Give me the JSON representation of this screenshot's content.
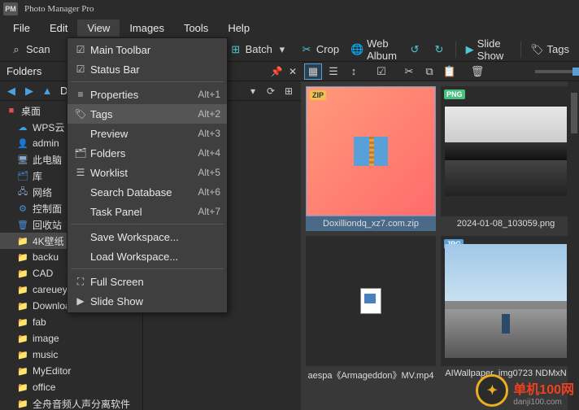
{
  "app": {
    "logo": "PM",
    "title": "Photo Manager Pro"
  },
  "menubar": {
    "file": "File",
    "edit": "Edit",
    "view": "View",
    "images": "Images",
    "tools": "Tools",
    "help": "Help"
  },
  "toolbar": {
    "scan": "Scan",
    "batch": "Batch",
    "crop": "Crop",
    "webalbum": "Web Album",
    "slideshow": "Slide Show",
    "tags": "Tags"
  },
  "folders_label": "Folders",
  "breadcrumb": "D",
  "view_menu": {
    "main_toolbar": "Main Toolbar",
    "status_bar": "Status Bar",
    "properties": "Properties",
    "properties_sc": "Alt+1",
    "tags": "Tags",
    "tags_sc": "Alt+2",
    "preview": "Preview",
    "preview_sc": "Alt+3",
    "folders": "Folders",
    "folders_sc": "Alt+4",
    "worklist": "Worklist",
    "worklist_sc": "Alt+5",
    "search_db": "Search Database",
    "search_db_sc": "Alt+6",
    "task_panel": "Task Panel",
    "task_panel_sc": "Alt+7",
    "save_ws": "Save Workspace...",
    "load_ws": "Load Workspace...",
    "full_screen": "Full Screen",
    "slide_show": "Slide Show"
  },
  "tree": {
    "desktop": "桌面",
    "wps": "WPS云",
    "admin": "admin",
    "thispc": "此电脑",
    "lib": "库",
    "network": "网络",
    "control": "控制面",
    "recycle": "回收站",
    "k4": "4K壁纸",
    "backup": "backu",
    "cad": "CAD",
    "careueyes": "careueyes_xxxxx",
    "download": "Download",
    "fab": "fab",
    "image": "image",
    "music": "music",
    "myeditor": "MyEditor",
    "office": "office",
    "last": "全舟音频人声分离软件"
  },
  "thumbs": {
    "t1": "Doxilliondq_xz7.com.zip",
    "t2": "2024-01-08_103059.png",
    "t3": "aespa《Armageddon》MV.mp4",
    "t4": "AIWallpaper_img0723 NDMxN"
  },
  "watermark": {
    "text": "单机100网",
    "sub": "danji100.com"
  }
}
